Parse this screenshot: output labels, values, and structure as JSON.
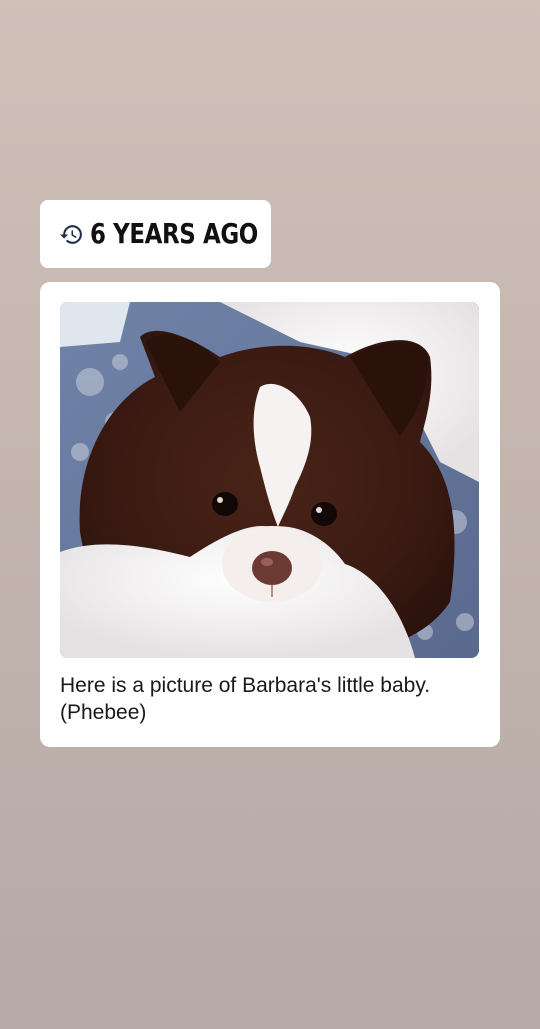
{
  "memory": {
    "icon": "history-icon",
    "label": "6 YEARS AGO"
  },
  "post": {
    "image": {
      "subject": "pomeranian-dog-photo"
    },
    "caption": "Here is a picture of Barbara's little baby. (Phebee)"
  },
  "colors": {
    "background_top": "#cfc0b8",
    "background_bottom": "#b6a9a6",
    "card": "#ffffff",
    "icon": "#1f2f4a"
  }
}
